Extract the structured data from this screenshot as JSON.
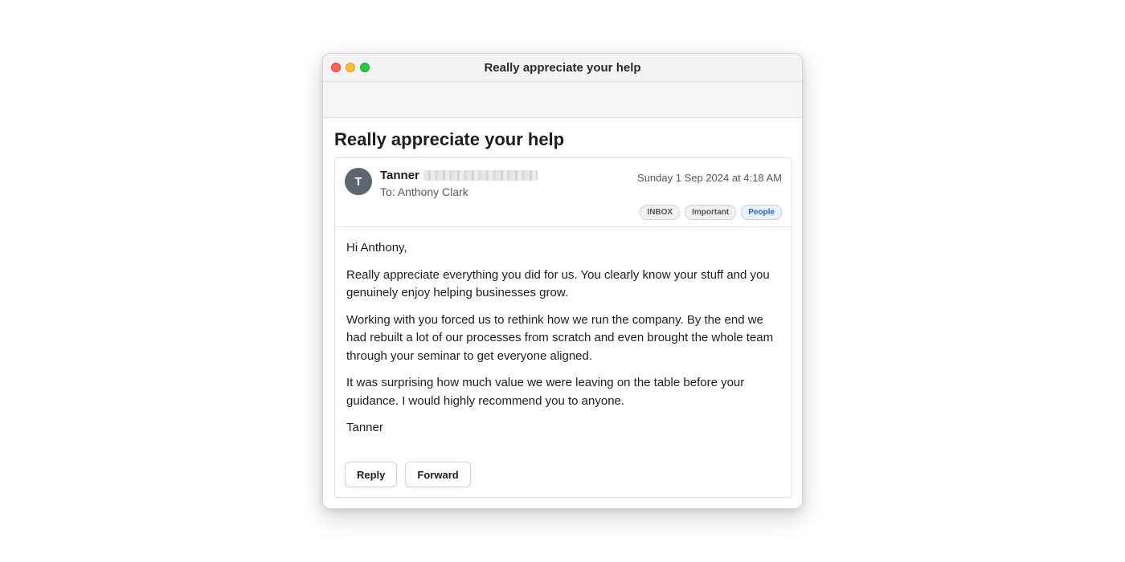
{
  "window": {
    "title": "Really appreciate your help"
  },
  "email": {
    "subject": "Really appreciate your help",
    "sender": {
      "name": "Tanner",
      "avatar_initial": "T"
    },
    "recipient": "To: Anthony Clark",
    "date": "Sunday 1 Sep 2024 at 4:18 AM",
    "labels": [
      "INBOX",
      "Important",
      "People"
    ],
    "body": {
      "greeting": "Hi Anthony,",
      "paragraphs": [
        "Really appreciate everything you did for us. You clearly know your stuff and you genuinely enjoy helping businesses grow.",
        "Working with you forced us to rethink how we run the company. By the end we had rebuilt a lot of our processes from scratch and even brought the whole team through your seminar to get everyone aligned.",
        "It was surprising how much value we were leaving on the table before your guidance. I would highly recommend you to anyone."
      ],
      "signature": "Tanner"
    },
    "actions": {
      "reply_label": "Reply",
      "forward_label": "Forward"
    }
  },
  "colors": {
    "avatar_bg": "#5d6670",
    "people_label": "#2a63b8",
    "traffic_close": "#ff5f57",
    "traffic_minimize": "#febc2e",
    "traffic_maximize": "#28c840"
  }
}
